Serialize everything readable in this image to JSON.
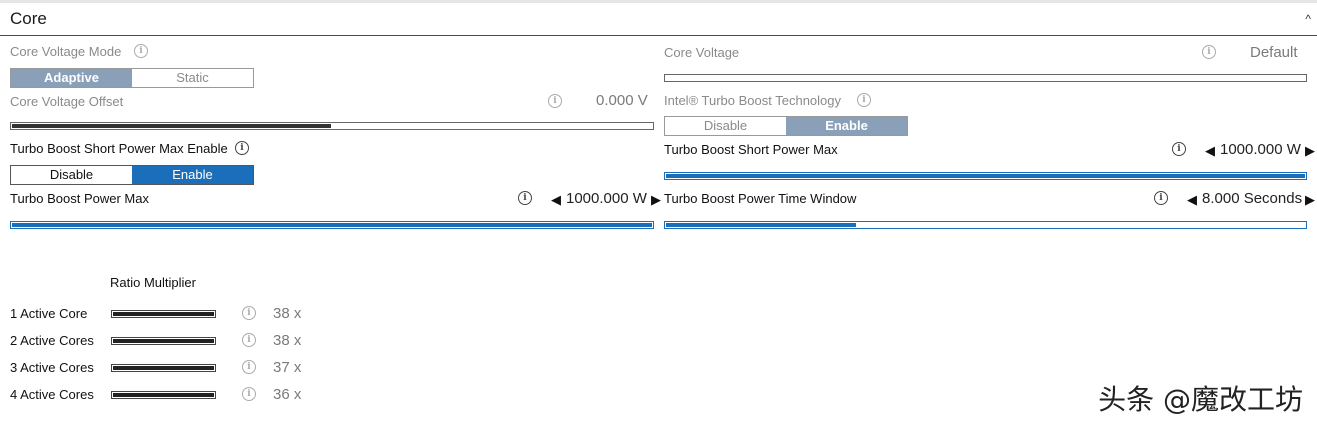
{
  "header": {
    "title": "Core"
  },
  "left": {
    "voltage_mode": {
      "label": "Core Voltage Mode",
      "options": [
        "Adaptive",
        "Static"
      ],
      "selected": 0
    },
    "voltage_offset": {
      "label": "Core Voltage Offset",
      "value": "0.000 V",
      "level": 0.5
    },
    "tb_short_enable": {
      "label": "Turbo Boost Short Power Max Enable",
      "options": [
        "Disable",
        "Enable"
      ],
      "selected": 1
    },
    "tb_power_max": {
      "label": "Turbo Boost Power Max",
      "value": "1000.000 W",
      "level": 1.0
    }
  },
  "right": {
    "core_voltage": {
      "label": "Core Voltage",
      "value": "Default",
      "level": 0.0
    },
    "turbo_boost_tech": {
      "label": "Intel® Turbo Boost Technology",
      "options": [
        "Disable",
        "Enable"
      ],
      "selected": 1
    },
    "tb_short_power_max": {
      "label": "Turbo Boost Short Power Max",
      "value": "1000.000 W",
      "level": 1.0
    },
    "tb_time_window": {
      "label": "Turbo Boost Power Time Window",
      "value": "8.000 Seconds",
      "level": 0.3
    }
  },
  "ratio": {
    "heading": "Ratio Multiplier",
    "rows": [
      {
        "label": "1 Active Core",
        "value": "38 x"
      },
      {
        "label": "2 Active Cores",
        "value": "38 x"
      },
      {
        "label": "3 Active Cores",
        "value": "37 x"
      },
      {
        "label": "4 Active Cores",
        "value": "36 x"
      }
    ]
  },
  "icons": {
    "info": "info-icon",
    "left": "triangle-left-icon",
    "right": "triangle-right-icon",
    "collapse": "chevron-up-icon"
  },
  "glyphs": {
    "info": "i",
    "left": "◀",
    "right": "▶",
    "collapse": "^"
  },
  "watermark": "头条 @魔改工坊",
  "colors": {
    "accent": "#1b6fba",
    "header_rule": "#1b5a7a"
  }
}
